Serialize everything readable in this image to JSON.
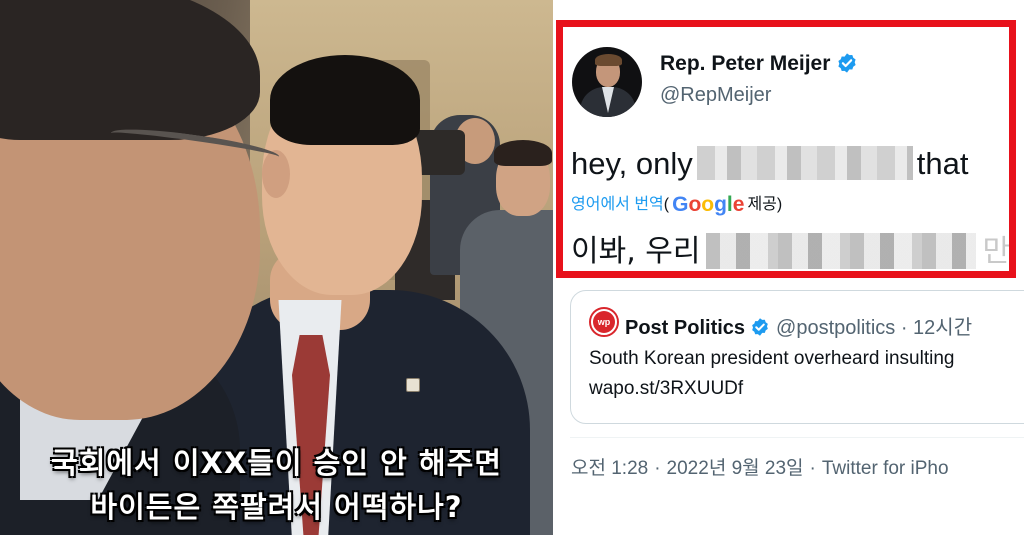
{
  "video": {
    "subtitle_line1": "국회에서 이XX들이 승인 안 해주면",
    "subtitle_line2": "바이든은 쪽팔려서 어떡하나?"
  },
  "tweet": {
    "author_name": "Rep. Peter Meijer",
    "author_handle": "@RepMeijer",
    "text_start": "hey, only",
    "text_end": "that",
    "translate_label": "영어에서 번역",
    "translate_open_paren": "(",
    "translate_provider_suffix": "제공)",
    "google_letters": [
      "G",
      "o",
      "o",
      "g",
      "l",
      "e"
    ],
    "translated_start": "이봐, 우리",
    "translated_trailing": "만",
    "verified_badge_icon": "verified-check-icon",
    "highlight_color": "#e8111b"
  },
  "quoted": {
    "author_name": "Post Politics",
    "handle": "@postpolitics",
    "time": "· 12시간",
    "avatar_text": "wp",
    "text": "South Korean president overheard insulting",
    "link": "wapo.st/3RXUUDf"
  },
  "meta": {
    "time": "오전 1:28",
    "date": "2022년 9월 23일",
    "source": "Twitter for iPho",
    "separator": "·"
  }
}
